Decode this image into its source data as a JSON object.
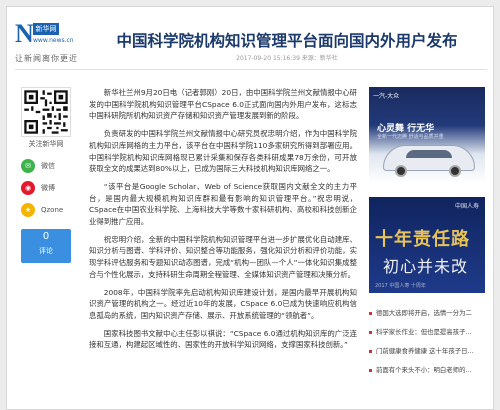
{
  "header": {
    "logo_letter": "N",
    "logo_badge": "新华网",
    "logo_url": "www.news.cn",
    "logo_slogan": "让新闻离你更近",
    "title": "中国科学院机构知识管理平台面向国内外用户发布",
    "meta": "2017-09-20 15:16:39   来源：新华社"
  },
  "sidebar": {
    "follow_label": "关注新华网",
    "share": [
      {
        "label": "微信",
        "icon": "wechat-icon",
        "color": "#3db34a"
      },
      {
        "label": "微博",
        "icon": "weibo-icon",
        "color": "#e6162d"
      },
      {
        "label": "Qzone",
        "icon": "qzone-icon",
        "color": "#f5b400"
      }
    ],
    "comment_count": "0",
    "comment_label": "评论"
  },
  "article": {
    "paragraphs": [
      "新华社兰州9月20日电（记者郭刚）20日，由中国科学院兰州文献情报中心研发的中国科学院机构知识管理平台CSpace 6.0正式面向国内外用户发布，这标志中国科研院所机构知识资产存储和知识资产管理发展到新的阶段。",
      "负责研发的中国科学院兰州文献情报中心研究员祝忠明介绍，作为中国科学院机构知识库网格的主力平台，该平台在中国科学院110多家研究所得到部署应用。中国科学院机构知识库网格现已累计采集和保存各类科研成果78万余份，可开放获取全文的成果达到80%以上，已成为国际三大科技机构知识库网络之一。",
      "“该平台是Google Scholar、Web of Science获取国内文献全文的主力平台，是国内最大规模机构知识库群和最有影响的知识管理平台。”祝忠明说，CSpace在中国农业科学院、上海科技大学等数十家科研机构、高校和科技创新企业得到推广应用。",
      "祝忠明介绍，全新的中国科学院机构知识管理平台进一步扩展优化自动建库、知识分析与图谱、学科评价、知识整合等功能服务，强化知识分析和评价功能，实现学科评估服务和专题知识动态图谱，完成“机构—团队—个人”一体化知识集成整合与个性化展示，支持科研生命周期全程管理、全媒体知识资产管理和决策分析。",
      "2008年，中国科学院率先启动机构知识库建设计划，是国内最早开展机构知识资产管理的机构之一。经过近10年的发展，CSpace 6.0已成为快速响应机构信息孤岛的系统，国内知识资产存储、展示、开放系统管理的“领航者”。",
      "国家科技图书文献中心主任彭以祺说：“CSpace 6.0通过机构知识库的广泛连接和互通，构建起区域性的、国家性的开放科学知识网络，支撑国家科技创新。”"
    ]
  },
  "ads": [
    {
      "top": "一汽-大众",
      "head": "心灵舞 行无华",
      "sub": "全新一代迈腾 舒适与品质并重"
    },
    {
      "brand": "中国人寿",
      "line1": "十年责任路",
      "line2": "初心并未改",
      "foot": "2017 中国人寿 十周年"
    }
  ],
  "recommendations": [
    "德国大选即将开启，选情一分为二",
    "科学家长作业：但也是提高孩子...",
    "门前健康食养健康 这十年孩子日...",
    "前面有个来头不小：明白老师的..."
  ]
}
